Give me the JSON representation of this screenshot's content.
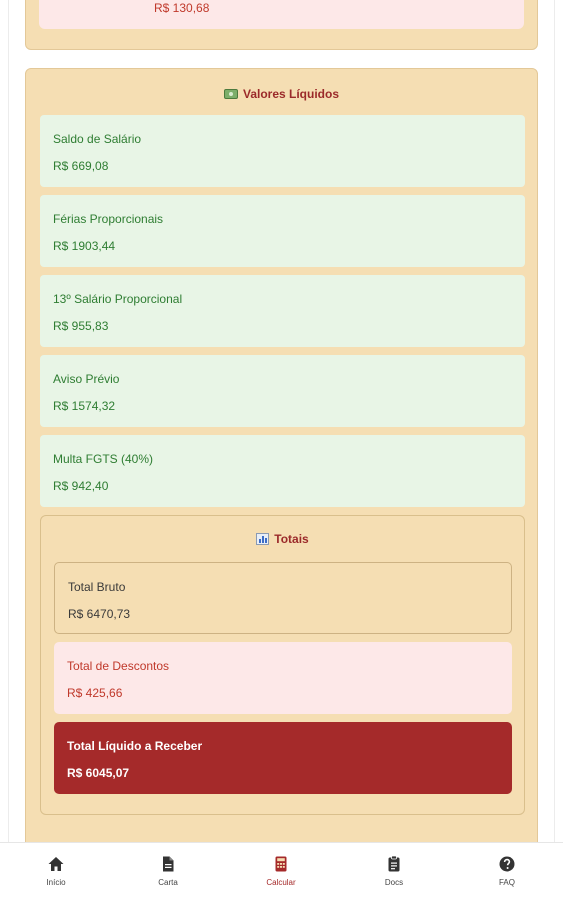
{
  "top_card": {
    "value": "R$ 130,68"
  },
  "valores_liquidos": {
    "title": "Valores Líquidos",
    "items": [
      {
        "label": "Saldo de Salário",
        "value": "R$ 669,08"
      },
      {
        "label": "Férias Proporcionais",
        "value": "R$ 1903,44"
      },
      {
        "label": "13º Salário Proporcional",
        "value": "R$ 955,83"
      },
      {
        "label": "Aviso Prévio",
        "value": "R$ 1574,32"
      },
      {
        "label": "Multa FGTS (40%)",
        "value": "R$ 942,40"
      }
    ]
  },
  "totais": {
    "title": "Totais",
    "bruto": {
      "label": "Total Bruto",
      "value": "R$ 6470,73"
    },
    "descontos": {
      "label": "Total de Descontos",
      "value": "R$ 425,66"
    },
    "liquido": {
      "label": "Total Líquido a Receber",
      "value": "R$ 6045,07"
    }
  },
  "nav": {
    "items": [
      {
        "label": "Início",
        "icon": "home-icon"
      },
      {
        "label": "Carta",
        "icon": "document-icon"
      },
      {
        "label": "Calcular",
        "icon": "calculator-icon",
        "active": true
      },
      {
        "label": "Docs",
        "icon": "clipboard-icon"
      },
      {
        "label": "FAQ",
        "icon": "help-icon"
      }
    ]
  },
  "colors": {
    "section_bg": "#f5deb3",
    "green_card_bg": "#e8f5e6",
    "green_text": "#2e7d32",
    "accent_red": "#a52a2a",
    "desc_bg": "#fde8e8"
  }
}
